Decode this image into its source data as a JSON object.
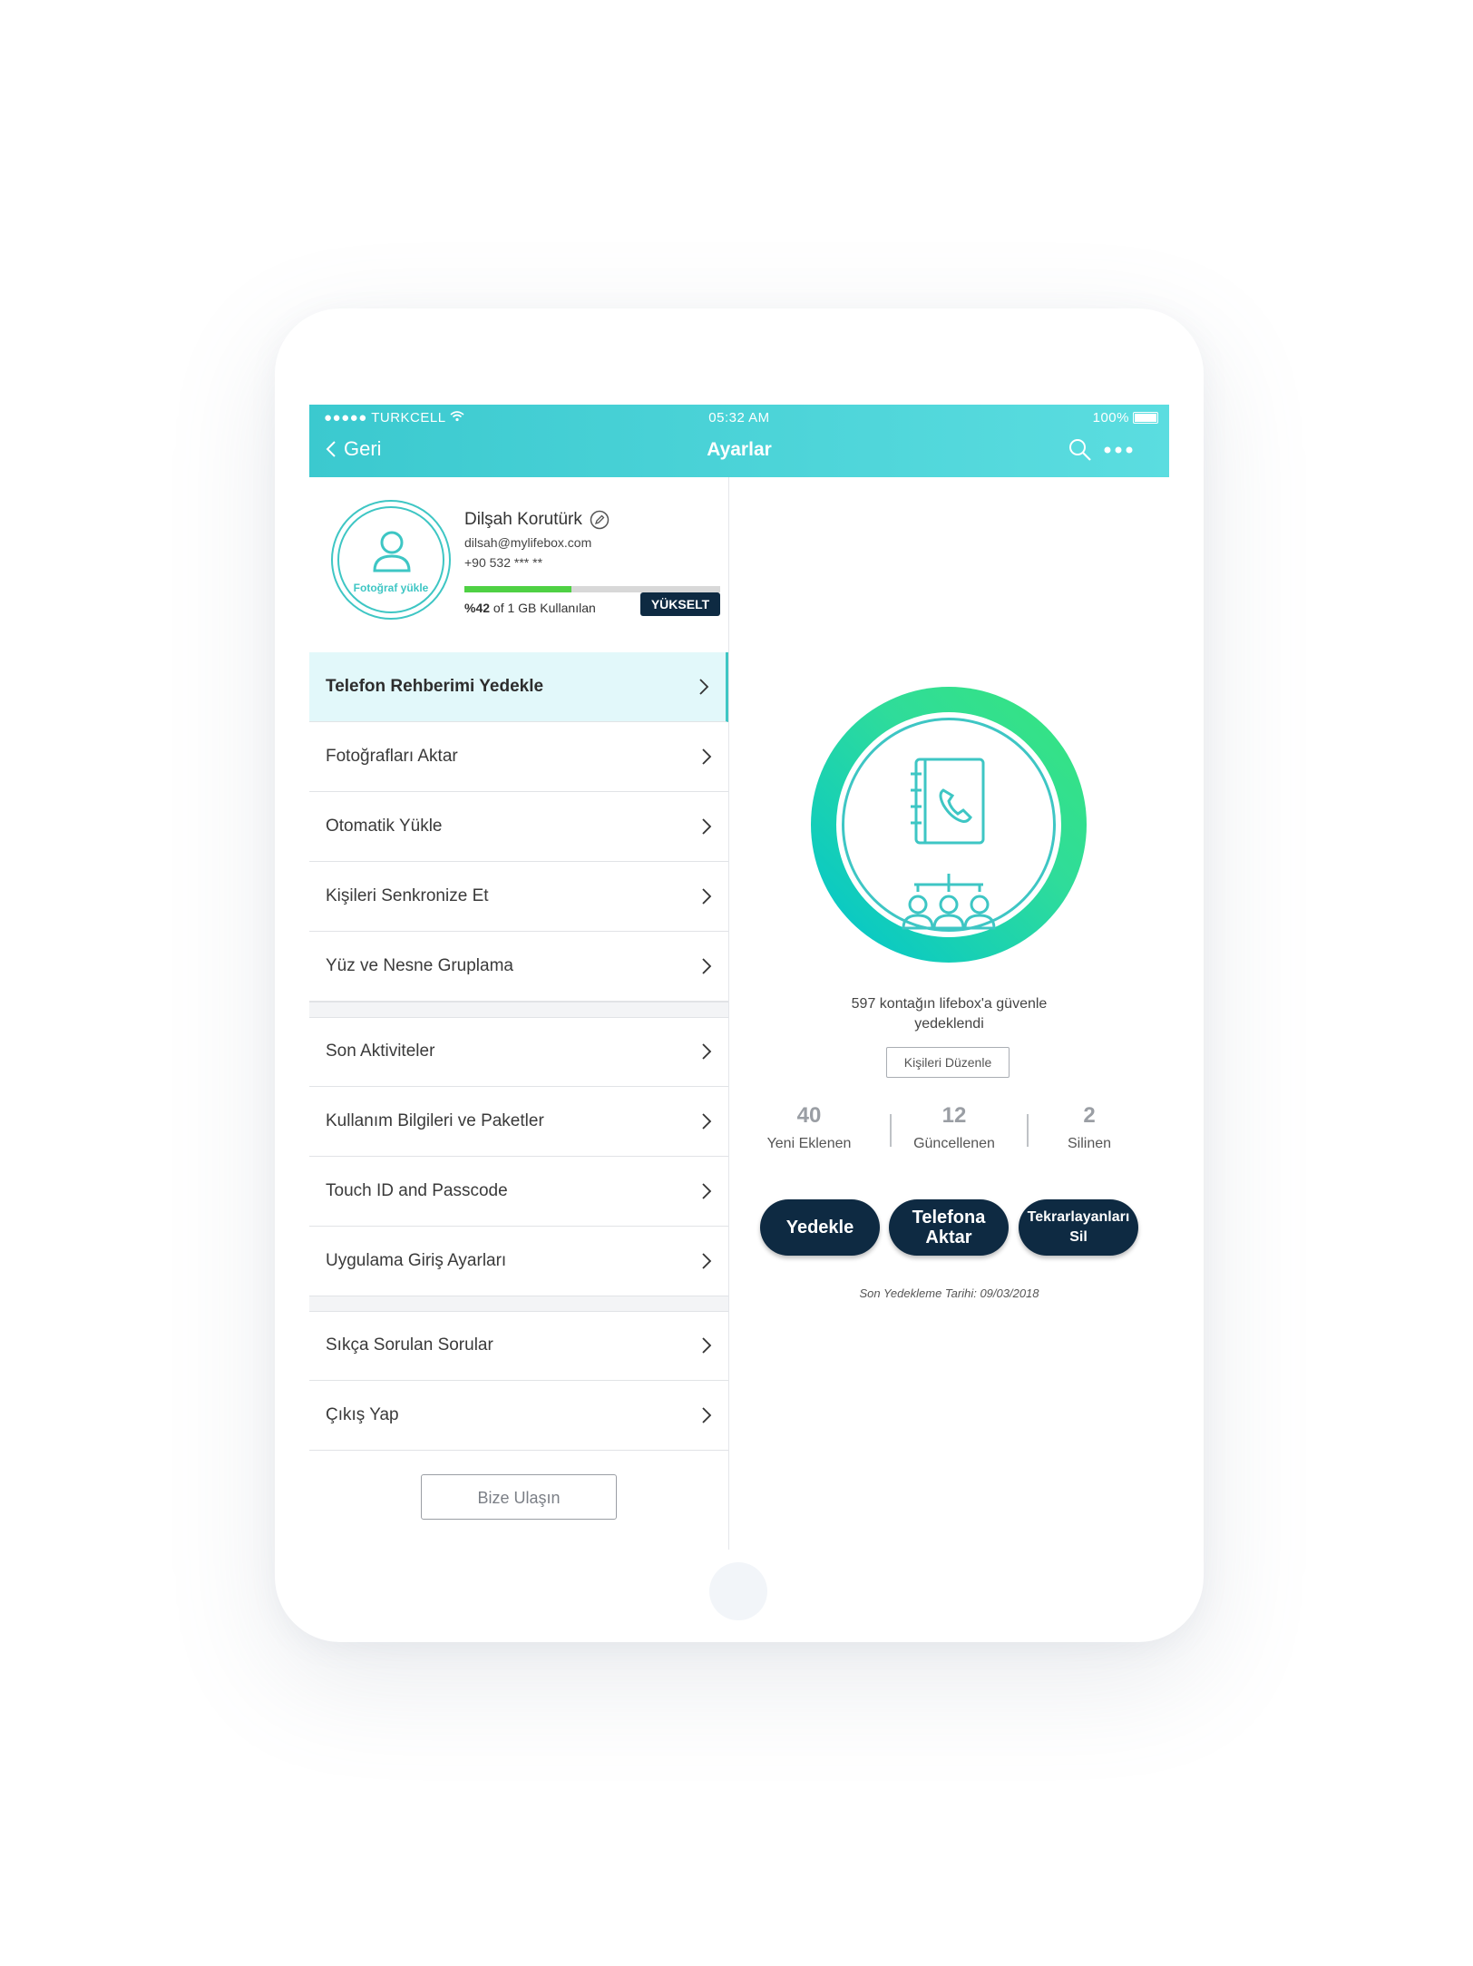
{
  "status_bar": {
    "carrier": "●●●●● TURKCELL",
    "time": "05:32 AM",
    "battery": "100%"
  },
  "nav": {
    "back_label": "Geri",
    "title": "Ayarlar"
  },
  "profile": {
    "avatar_label": "Fotoğraf yükle",
    "name": "Dilşah Korutürk",
    "email": "dilsah@mylifebox.com",
    "phone": "+90 532 *** **",
    "quota_percent": 42,
    "quota_percent_label": "%42",
    "quota_suffix": " of 1 GB Kullanılan",
    "upgrade_label": "YÜKSELT"
  },
  "menu": {
    "group1": [
      {
        "label": "Telefon Rehberimi Yedekle"
      },
      {
        "label": "Fotoğrafları Aktar"
      },
      {
        "label": "Otomatik Yükle"
      },
      {
        "label": "Kişileri Senkronize Et"
      },
      {
        "label": "Yüz ve Nesne Gruplama"
      }
    ],
    "group2": [
      {
        "label": "Son Aktiviteler"
      },
      {
        "label": "Kullanım Bilgileri ve Paketler"
      },
      {
        "label": "Touch ID and Passcode"
      },
      {
        "label": "Uygulama Giriş Ayarları"
      }
    ],
    "group3": [
      {
        "label": "Sıkça Sorulan Sorular"
      },
      {
        "label": "Çıkış Yap"
      }
    ],
    "contact_label": "Bize Ulaşın"
  },
  "backup": {
    "message_line1": "597 kontağın lifebox'a güvenle",
    "message_line2": "yedeklendi",
    "edit_label": "Kişileri Düzenle",
    "stats": [
      {
        "value": "40",
        "label": "Yeni Eklenen"
      },
      {
        "value": "12",
        "label": "Güncellenen"
      },
      {
        "value": "2",
        "label": "Silinen"
      }
    ],
    "btn_backup": "Yedekle",
    "btn_restore_1": "Telefona",
    "btn_restore_2": "Aktar",
    "btn_dedupe_1": "Tekrarlayanları",
    "btn_dedupe_2": "Sil",
    "last_backup": "Son Yedekleme Tarihi: 09/03/2018"
  },
  "colors": {
    "accent": "#3ec6c4",
    "dark_button": "#0e2a42",
    "quota_fill": "#4fd144"
  }
}
